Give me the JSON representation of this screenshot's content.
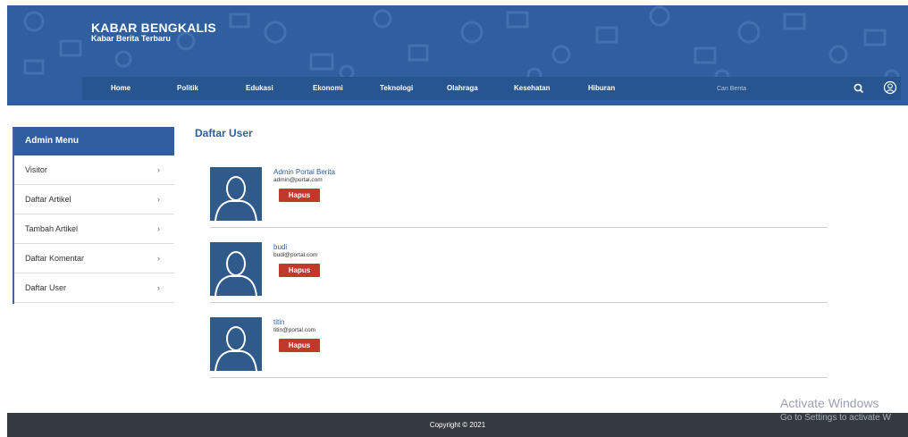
{
  "brand": {
    "title": "KABAR BENGKALIS",
    "subtitle": "Kabar Berita Terbaru"
  },
  "nav": {
    "items": [
      "Home",
      "Politik",
      "Edukasi",
      "Ekonomi",
      "Teknologi",
      "Olahraga",
      "Kesehatan",
      "Hiburan"
    ],
    "search_placeholder": "Cari Berita",
    "icons": {
      "search": "search-icon",
      "user": "user-circle-icon"
    }
  },
  "sidebar": {
    "header": "Admin Menu",
    "items": [
      {
        "label": "Visitor",
        "chevron": "›"
      },
      {
        "label": "Daftar Artikel",
        "chevron": "›"
      },
      {
        "label": "Tambah Artikel",
        "chevron": "›"
      },
      {
        "label": "Daftar Komentar",
        "chevron": "›"
      },
      {
        "label": "Daftar User",
        "chevron": "›"
      }
    ]
  },
  "main": {
    "title": "Daftar User",
    "users": [
      {
        "name": "Admin Portal Berita",
        "email": "admin@portal.com",
        "action": "Hapus"
      },
      {
        "name": "budi",
        "email": "budi@portal.com",
        "action": "Hapus"
      },
      {
        "name": "titin",
        "email": "titin@portal.com",
        "action": "Hapus"
      }
    ]
  },
  "watermark": {
    "line1": "Activate Windows",
    "line2": "Go to Settings to activate W"
  },
  "footer": {
    "text": "Copyright © 2021"
  },
  "colors": {
    "primary": "#2f5f9e",
    "nav": "#26558f",
    "danger": "#c0392b",
    "footer": "#343a40"
  }
}
